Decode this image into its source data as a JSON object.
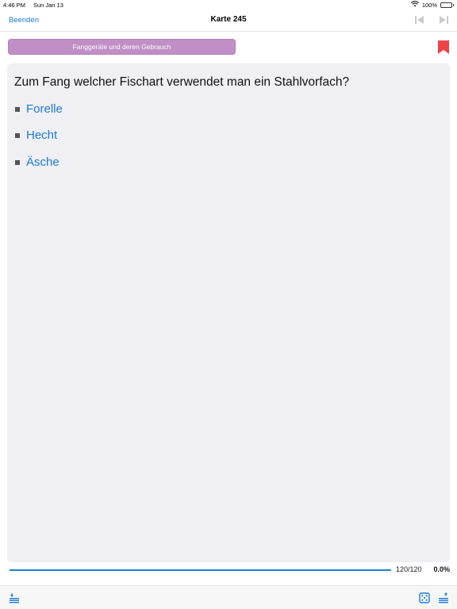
{
  "status_bar": {
    "time": "4:46 PM",
    "date": "Sun Jan 13",
    "battery": "100%",
    "icons": [
      "wifi-icon",
      "battery-icon"
    ]
  },
  "nav": {
    "back_label": "Beenden",
    "title": "Karte 245",
    "icons": [
      "previous-card-icon",
      "next-card-icon"
    ]
  },
  "category": {
    "label": "Fanggeräte und deren Gebrauch",
    "color": "#c08fc6"
  },
  "bookmark": {
    "icon": "bookmark-icon",
    "color": "#f04347"
  },
  "card": {
    "question": "Zum Fang welcher Fischart verwendet man ein Stahlvorfach?",
    "answers": [
      {
        "label": "Forelle"
      },
      {
        "label": "Hecht"
      },
      {
        "label": "Äsche"
      }
    ]
  },
  "progress": {
    "fraction": 1.0,
    "count": "120/120",
    "percent": "0.0%"
  },
  "toolbar": {
    "icons": [
      "stack-icon",
      "dice-icon",
      "stack-icon"
    ]
  },
  "colors": {
    "accent": "#1a7bd8",
    "card_background": "#f0eff4"
  }
}
